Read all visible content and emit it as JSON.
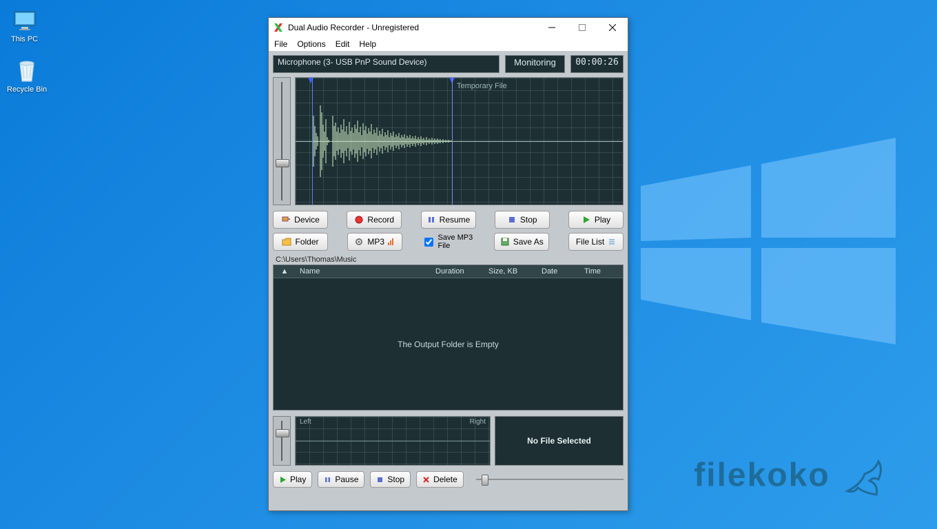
{
  "desktop": {
    "thispc": "This PC",
    "recycle": "Recycle Bin"
  },
  "window": {
    "title": "Dual Audio Recorder - Unregistered",
    "menu": {
      "file": "File",
      "options": "Options",
      "edit": "Edit",
      "help": "Help"
    },
    "device": "Microphone (3- USB PnP Sound Device)",
    "status": "Monitoring",
    "timer": "00:00:26",
    "wave_label": "Temporary File",
    "buttons": {
      "device": "Device",
      "record": "Record",
      "resume": "Resume",
      "stop": "Stop",
      "play": "Play",
      "folder": "Folder",
      "mp3": "MP3",
      "savechk": "Save MP3 File",
      "saveas": "Save As",
      "filelist": "File List"
    },
    "path": "C:\\Users\\Thomas\\Music",
    "cols": {
      "name": "Name",
      "duration": "Duration",
      "size": "Size, KB",
      "date": "Date",
      "time": "Time"
    },
    "empty": "The Output Folder is Empty",
    "preview": {
      "left": "Left",
      "right": "Right",
      "nofile": "No File Selected"
    },
    "pbuttons": {
      "play": "Play",
      "pause": "Pause",
      "stop": "Stop",
      "delete": "Delete"
    }
  },
  "watermark": "filekoko"
}
